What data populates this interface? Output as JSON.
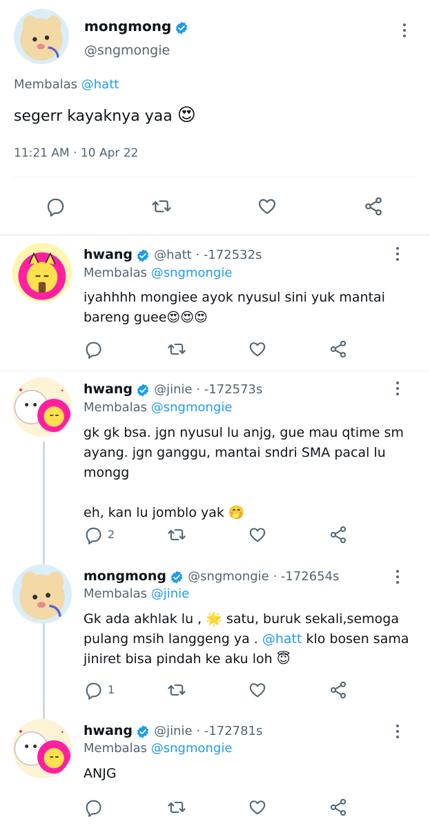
{
  "main_tweet": {
    "name": "mongmong",
    "handle": "@sngmongie",
    "reply_prefix": "Membalas",
    "reply_to": "@hatt",
    "text": "segerr kayaknya yaa",
    "emoji": "😍",
    "timestamp": "11:21 AM · 10 Apr 22"
  },
  "replies": [
    {
      "name": "hwang",
      "handle": "@hatt",
      "time": " · -172532s",
      "reply_prefix": "Membalas",
      "reply_to": "@sngmongie",
      "text_line1": "iyahhhh mongiee ayok nyusul sini yuk mantai",
      "text_line2": "bareng guee😍😍😍",
      "reply_count": ""
    },
    {
      "name": "hwang",
      "handle": "@jinie",
      "time": " · -172573s",
      "reply_prefix": "Membalas",
      "reply_to": "@sngmongie",
      "text_line1": "gk gk bsa. jgn nyusul lu anjg, gue mau qtime sm",
      "text_line2": "ayang. jgn ganggu, mantai sndri SMA pacal lu",
      "text_line3": "mongg",
      "text_line4": "eh, kan lu jomblo yak 🤭",
      "reply_count": "2"
    },
    {
      "name": "mongmong",
      "handle": "@sngmongie",
      "time": " · -172654s",
      "reply_prefix": "Membalas",
      "reply_to": "@jinie",
      "text_line1": "Gk ada akhlak lu ,  🌟 satu, buruk sekali,semoga",
      "text_line2": "pulang msih langgeng ya . ",
      "text_mention": "@hatt",
      "text_line2b": " klo bosen sama",
      "text_line3": "jiniret bisa pindah ke aku loh  😇",
      "reply_count": "1"
    },
    {
      "name": "hwang",
      "handle": "@jinie",
      "time": " · -172781s",
      "reply_prefix": "Membalas",
      "reply_to": "@sngmongie",
      "text_line1": "ANJG",
      "reply_count": ""
    }
  ],
  "icons": {
    "reply": "reply-icon",
    "retweet": "retweet-icon",
    "like": "like-icon",
    "share": "share-icon",
    "more": "more-icon",
    "verified": "verified-badge-icon"
  },
  "colors": {
    "accent": "#1d9bf0",
    "secondary_text": "#536471",
    "divider": "#eff3f4"
  }
}
